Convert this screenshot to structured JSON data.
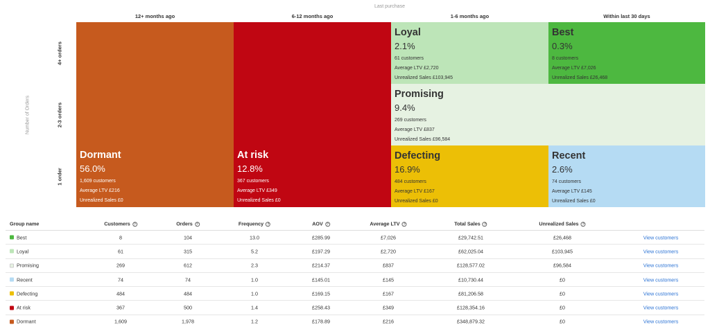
{
  "axis": {
    "top_label": "Last purchase",
    "side_label": "Number of Orders",
    "columns": [
      "12+ months ago",
      "6-12 months ago",
      "1-6 months ago",
      "Within last 30 days"
    ],
    "rows": [
      "4+ orders",
      "2-3 orders",
      "1 order"
    ]
  },
  "segments": {
    "dormant": {
      "title": "Dormant",
      "pct": "56.0%",
      "customers": "1,609 customers",
      "ltv": "Average LTV £216",
      "unrealized": "Unrealized Sales £0",
      "color": "#c65a1e"
    },
    "at_risk": {
      "title": "At risk",
      "pct": "12.8%",
      "customers": "367 customers",
      "ltv": "Average LTV £349",
      "unrealized": "Unrealized Sales £0",
      "color": "#c00612"
    },
    "loyal": {
      "title": "Loyal",
      "pct": "2.1%",
      "customers": "61 customers",
      "ltv": "Average LTV £2,720",
      "unrealized": "Unrealized Sales £103,945",
      "color": "#bde5b8"
    },
    "best": {
      "title": "Best",
      "pct": "0.3%",
      "customers": "8 customers",
      "ltv": "Average LTV £7,026",
      "unrealized": "Unrealized Sales £26,468",
      "color": "#4db840"
    },
    "promising": {
      "title": "Promising",
      "pct": "9.4%",
      "customers": "269 customers",
      "ltv": "Average LTV £837",
      "unrealized": "Unrealized Sales £96,584",
      "color": "#e6f2e2"
    },
    "defecting": {
      "title": "Defecting",
      "pct": "16.9%",
      "customers": "484 customers",
      "ltv": "Average LTV £167",
      "unrealized": "Unrealized Sales £0",
      "color": "#ecbf06"
    },
    "recent": {
      "title": "Recent",
      "pct": "2.6%",
      "customers": "74 customers",
      "ltv": "Average LTV £145",
      "unrealized": "Unrealized Sales £0",
      "color": "#b5dbf3"
    }
  },
  "table": {
    "headers": [
      "Group name",
      "Customers",
      "Orders",
      "Frequency",
      "AOV",
      "Average LTV",
      "Total Sales",
      "Unrealized Sales"
    ],
    "link_label": "View customers",
    "rows": [
      {
        "name": "Best",
        "color": "#4db840",
        "customers": "8",
        "orders": "104",
        "frequency": "13.0",
        "aov": "£285.99",
        "ltv": "£7,026",
        "total": "£29,742.51",
        "unrealized": "£26,468"
      },
      {
        "name": "Loyal",
        "color": "#bde5b8",
        "customers": "61",
        "orders": "315",
        "frequency": "5.2",
        "aov": "£197.29",
        "ltv": "£2,720",
        "total": "£62,025.04",
        "unrealized": "£103,945"
      },
      {
        "name": "Promising",
        "color": "#e6f2e2",
        "customers": "269",
        "orders": "612",
        "frequency": "2.3",
        "aov": "£214.37",
        "ltv": "£837",
        "total": "£128,577.02",
        "unrealized": "£96,584"
      },
      {
        "name": "Recent",
        "color": "#b5dbf3",
        "customers": "74",
        "orders": "74",
        "frequency": "1.0",
        "aov": "£145.01",
        "ltv": "£145",
        "total": "£10,730.44",
        "unrealized": "£0"
      },
      {
        "name": "Defecting",
        "color": "#ecbf06",
        "customers": "484",
        "orders": "484",
        "frequency": "1.0",
        "aov": "£169.15",
        "ltv": "£167",
        "total": "£81,206.58",
        "unrealized": "£0"
      },
      {
        "name": "At risk",
        "color": "#c00612",
        "customers": "367",
        "orders": "500",
        "frequency": "1.4",
        "aov": "£258.43",
        "ltv": "£349",
        "total": "£128,354.16",
        "unrealized": "£0"
      },
      {
        "name": "Dormant",
        "color": "#c65a1e",
        "customers": "1,609",
        "orders": "1,978",
        "frequency": "1.2",
        "aov": "£178.89",
        "ltv": "£216",
        "total": "£348,879.32",
        "unrealized": "£0"
      }
    ]
  }
}
